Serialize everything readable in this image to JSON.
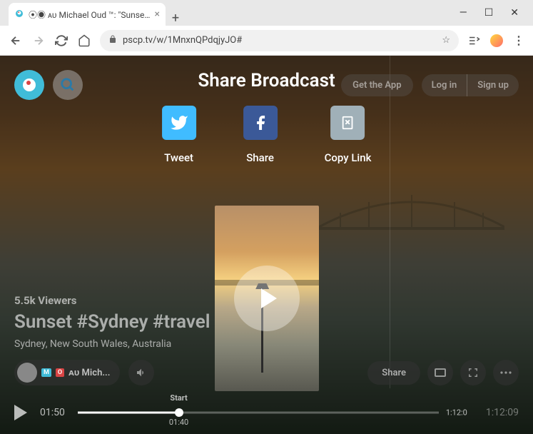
{
  "browser": {
    "tab_title": "⦿◉ ᴀᴜ Michael Oud ™: \"Sunset #",
    "url": "pscp.tv/w/1MnxnQPdqjyJO#"
  },
  "header": {
    "get_app": "Get the App",
    "log_in": "Log in",
    "sign_up": "Sign up"
  },
  "share_modal": {
    "title": "Share Broadcast",
    "tweet": "Tweet",
    "share": "Share",
    "copy_link": "Copy Link"
  },
  "stream": {
    "viewers": "5.5k Viewers",
    "title": "Sunset #Sydney #travel",
    "location": "Sydney, New South Wales, Australia",
    "broadcaster": "ᴀᴜ Mich...",
    "share_label": "Share"
  },
  "player": {
    "current_time": "01:50",
    "start_label": "Start",
    "start_time": "01:40",
    "end_marker": "1:12:0",
    "total_time": "1:12:09"
  }
}
